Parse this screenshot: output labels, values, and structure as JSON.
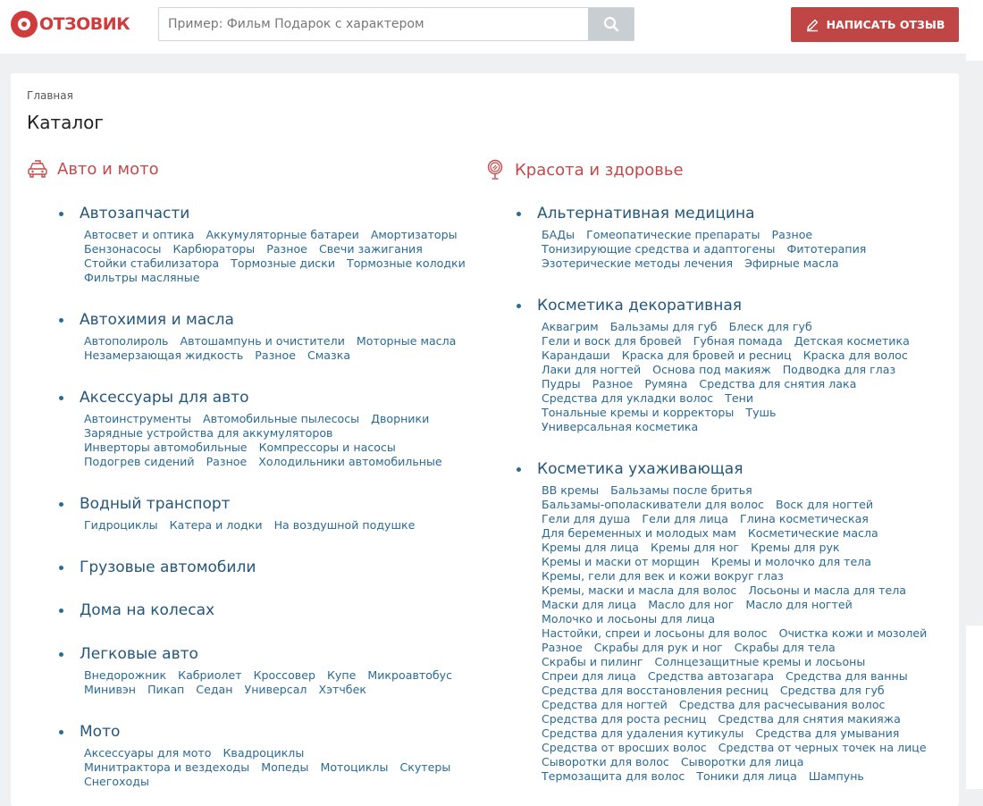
{
  "header": {
    "logo_text": "ОТЗОВИК",
    "search_placeholder": "Пример: Фильм Подарок с характером",
    "write_button": "НАПИСАТЬ ОТЗЫВ",
    "brand_color": "#d03b3b",
    "button_color": "#c04545"
  },
  "breadcrumb": "Главная",
  "page_title": "Каталог",
  "columns": [
    {
      "title": "Авто и мото",
      "icon": "car-icon",
      "subcategories": [
        {
          "title": "Автозапчасти",
          "links": [
            "Автосвет и оптика",
            "Аккумуляторные батареи",
            "Амортизаторы",
            "Бензонасосы",
            "Карбюраторы",
            "Разное",
            "Свечи зажигания",
            "Стойки стабилизатора",
            "Тормозные диски",
            "Тормозные колодки",
            "Фильтры масляные"
          ]
        },
        {
          "title": "Автохимия и масла",
          "links": [
            "Автополироль",
            "Автошампунь и очистители",
            "Моторные масла",
            "Незамерзающая жидкость",
            "Разное",
            "Смазка"
          ]
        },
        {
          "title": "Аксессуары для авто",
          "links": [
            "Автоинструменты",
            "Автомобильные пылесосы",
            "Дворники",
            "Зарядные устройства для аккумуляторов",
            "Инверторы автомобильные",
            "Компрессоры и насосы",
            "Подогрев сидений",
            "Разное",
            "Холодильники автомобильные"
          ]
        },
        {
          "title": "Водный транспорт",
          "links": [
            "Гидроциклы",
            "Катера и лодки",
            "На воздушной подушке"
          ]
        },
        {
          "title": "Грузовые автомобили",
          "links": []
        },
        {
          "title": "Дома на колесах",
          "links": []
        },
        {
          "title": "Легковые авто",
          "links": [
            "Внедорожник",
            "Кабриолет",
            "Кроссовер",
            "Купе",
            "Микроавтобус",
            "Минивэн",
            "Пикап",
            "Седан",
            "Универсал",
            "Хэтчбек"
          ]
        },
        {
          "title": "Мото",
          "links": [
            "Аксессуары для мото",
            "Квадроциклы",
            "Минитрактора и вездеходы",
            "Мопеды",
            "Мотоциклы",
            "Скутеры",
            "Снегоходы"
          ]
        }
      ]
    },
    {
      "title": "Красота и здоровье",
      "icon": "mirror-icon",
      "subcategories": [
        {
          "title": "Альтернативная медицина",
          "links": [
            "БАДы",
            "Гомеопатические препараты",
            "Разное",
            "Тонизирующие средства и адаптогены",
            "Фитотерапия",
            "Эзотерические методы лечения",
            "Эфирные масла"
          ]
        },
        {
          "title": "Косметика декоративная",
          "links": [
            "Аквагрим",
            "Бальзамы для губ",
            "Блеск для губ",
            "Гели и воск для бровей",
            "Губная помада",
            "Детская косметика",
            "Карандаши",
            "Краска для бровей и ресниц",
            "Краска для волос",
            "Лаки для ногтей",
            "Основа под макияж",
            "Подводка для глаз",
            "Пудры",
            "Разное",
            "Румяна",
            "Средства для снятия лака",
            "Средства для укладки волос",
            "Тени",
            "Тональные кремы и корректоры",
            "Тушь",
            "Универсальная косметика"
          ]
        },
        {
          "title": "Косметика ухаживающая",
          "links": [
            "BB кремы",
            "Бальзамы после бритья",
            "Бальзамы-ополаскиватели для волос",
            "Воск для ногтей",
            "Гели для душа",
            "Гели для лица",
            "Глина косметическая",
            "Для беременных и молодых мам",
            "Косметические масла",
            "Кремы для лица",
            "Кремы для ног",
            "Кремы для рук",
            "Кремы и маски от морщин",
            "Кремы и молочко для тела",
            "Кремы, гели для век и кожи вокруг глаз",
            "Кремы, маски и масла для волос",
            "Лосьоны и масла для тела",
            "Маски для лица",
            "Масло для ног",
            "Масло для ногтей",
            "Молочко и лосьоны для лица",
            "Настойки, спреи и лосьоны для волос",
            "Очистка кожи и мозолей",
            "Разное",
            "Скрабы для рук и ног",
            "Скрабы для тела",
            "Скрабы и пилинг",
            "Солнцезащитные кремы и лосьоны",
            "Спреи для лица",
            "Средства автозагара",
            "Средства для ванны",
            "Средства для восстановления ресниц",
            "Средства для губ",
            "Средства для ногтей",
            "Средства для расчесывания волос",
            "Средства для роста ресниц",
            "Средства для снятия макияжа",
            "Средства для удаления кутикулы",
            "Средства для умывания",
            "Средства от вросших волос",
            "Средства от черных точек на лице",
            "Сыворотки для волос",
            "Сыворотки для лица",
            "Термозащита для волос",
            "Тоники для лица",
            "Шампунь"
          ]
        }
      ]
    }
  ]
}
